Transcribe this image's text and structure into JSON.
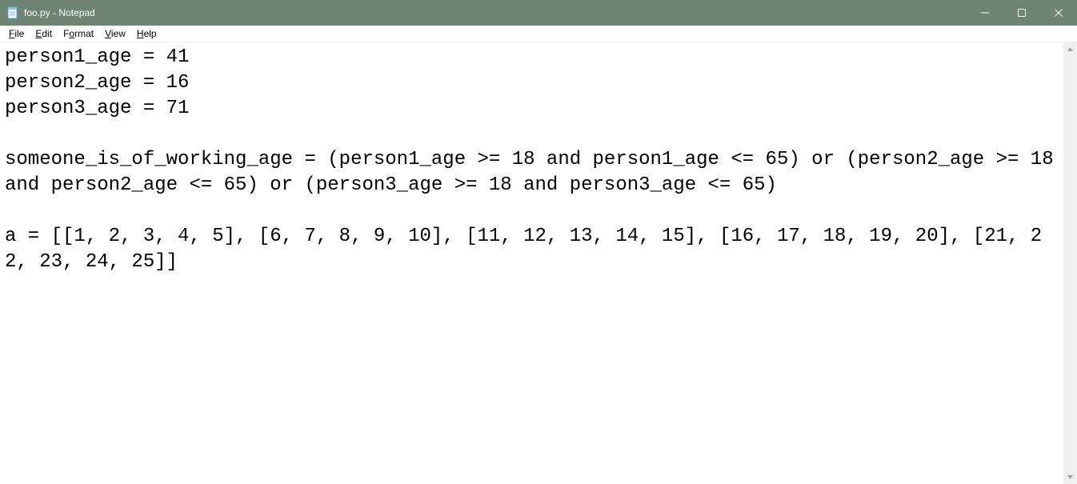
{
  "window": {
    "title": "foo.py - Notepad"
  },
  "menu": {
    "file": {
      "pre": "",
      "ul": "F",
      "post": "ile"
    },
    "edit": {
      "pre": "",
      "ul": "E",
      "post": "dit"
    },
    "format": {
      "pre": "F",
      "ul": "o",
      "post": "rmat"
    },
    "view": {
      "pre": "",
      "ul": "V",
      "post": "iew"
    },
    "help": {
      "pre": "",
      "ul": "H",
      "post": "elp"
    }
  },
  "editor": {
    "content": "person1_age = 41\nperson2_age = 16\nperson3_age = 71\n\nsomeone_is_of_working_age = (person1_age >= 18 and person1_age <= 65) or (person2_age >= 18 and person2_age <= 65) or (person3_age >= 18 and person3_age <= 65)\n\na = [[1, 2, 3, 4, 5], [6, 7, 8, 9, 10], [11, 12, 13, 14, 15], [16, 17, 18, 19, 20], [21, 22, 23, 24, 25]]\n"
  }
}
